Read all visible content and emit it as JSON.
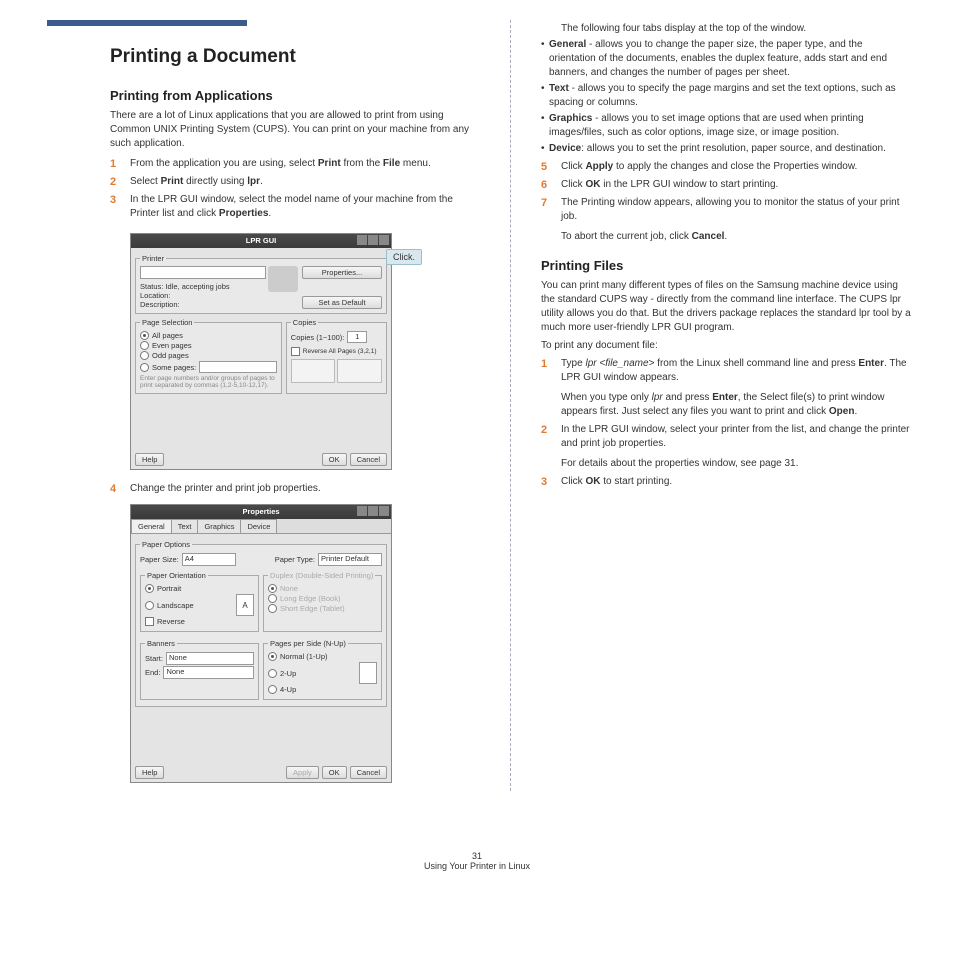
{
  "header": {
    "title": "Printing a Document"
  },
  "section1": {
    "title": "Printing from Applications",
    "intro": "There are a lot of Linux applications that you are allowed to print from using Common UNIX Printing System (CUPS). You can print on your machine from any such application.",
    "steps": {
      "s1a": "From the application you are using, select ",
      "s1b": "Print",
      "s1c": " from the ",
      "s1d": "File",
      "s1e": " menu.",
      "s2a": "Select ",
      "s2b": "Print",
      "s2c": " directly using ",
      "s2d": "lpr",
      "s2e": ".",
      "s3a": "In the LPR GUI window, select the model name of your machine from the Printer list and click ",
      "s3b": "Properties",
      "s3c": ".",
      "s4": "Change the printer and print job properties."
    }
  },
  "callout": {
    "click": "Click."
  },
  "lpr_mock": {
    "title": "LPR GUI",
    "printer_legend": "Printer",
    "status": "Status: Idle, accepting jobs",
    "location": "Location:",
    "description": "Description:",
    "properties_btn": "Properties...",
    "setdefault_btn": "Set as Default",
    "pagesel_legend": "Page Selection",
    "all_pages": "All pages",
    "even_pages": "Even pages",
    "odd_pages": "Odd pages",
    "some_pages": "Some pages:",
    "hint": "Enter page numbers and/or groups of pages to print separated by commas (1,2-5,10-12,17).",
    "copies_legend": "Copies",
    "copies_label": "Copies (1~100):",
    "copies_val": "1",
    "reverse": "Reverse All Pages (3,2,1)",
    "help": "Help",
    "ok": "OK",
    "cancel": "Cancel"
  },
  "props_mock": {
    "title": "Properties",
    "tabs": {
      "general": "General",
      "text": "Text",
      "graphics": "Graphics",
      "device": "Device"
    },
    "paperopt_legend": "Paper Options",
    "papersize": "Paper Size:",
    "papersize_val": "A4",
    "papertype": "Paper Type:",
    "papertype_val": "Printer Default",
    "orient_legend": "Paper Orientation",
    "portrait": "Portrait",
    "landscape": "Landscape",
    "reverse": "Reverse",
    "duplex_legend": "Duplex (Double-Sided Printing)",
    "none": "None",
    "long": "Long Edge (Book)",
    "short": "Short Edge (Tablet)",
    "banners_legend": "Banners",
    "start": "Start:",
    "end": "End:",
    "none_val": "None",
    "pps_legend": "Pages per Side (N-Up)",
    "normal": "Normal (1-Up)",
    "twoup": "2-Up",
    "fourup": "4-Up",
    "help": "Help",
    "apply": "Apply",
    "ok": "OK",
    "cancel": "Cancel"
  },
  "right": {
    "tabs_intro": "The following four tabs display at the top of the window.",
    "general_b": "General",
    "general_t": " - allows you to change the paper size, the paper type, and the orientation of the documents, enables the duplex feature, adds start and end banners, and changes the number of pages per sheet.",
    "text_b": "Text",
    "text_t": " - allows you to specify the page margins and set the text options, such as spacing or columns.",
    "graphics_b": "Graphics",
    "graphics_t": " - allows you to set image options that are used when printing images/files, such as color options, image size, or image position.",
    "device_b": "Device",
    "device_t": ": allows you to set the print resolution, paper source, and destination.",
    "s5a": "Click ",
    "s5b": "Apply",
    "s5c": " to apply the changes and close the Properties window.",
    "s6a": "Click ",
    "s6b": "OK",
    "s6c": " in the LPR GUI window to start printing.",
    "s7": "The Printing window appears, allowing you to monitor the status of your print job.",
    "s7sub_a": "To abort the current job, click ",
    "s7sub_b": "Cancel",
    "s7sub_c": "."
  },
  "section2": {
    "title": "Printing Files",
    "intro": "You can print many different types of files on the Samsung machine device using the standard CUPS way - directly from the command line interface. The CUPS lpr utility allows you do that. But the drivers package replaces the standard lpr tool by a much more user-friendly LPR GUI program.",
    "lead": "To print any document file:",
    "s1a": "Type ",
    "s1b": "lpr <file_name>",
    "s1c": " from the Linux shell command line and press ",
    "s1d": "Enter",
    "s1e": ". The LPR GUI window appears.",
    "s1sub_a": "When you type only ",
    "s1sub_b": "lpr",
    "s1sub_c": " and press ",
    "s1sub_d": "Enter",
    "s1sub_e": ", the Select file(s) to print window appears first. Just select any files you want to print and click ",
    "s1sub_f": "Open",
    "s1sub_g": ".",
    "s2": "In the LPR GUI window, select your printer from the list, and change the printer and print job properties.",
    "s2sub": "For details about the properties window, see page 31.",
    "s3a": "Click ",
    "s3b": "OK",
    "s3c": " to start printing."
  },
  "footer": {
    "page": "31",
    "caption": "Using Your Printer in Linux"
  }
}
